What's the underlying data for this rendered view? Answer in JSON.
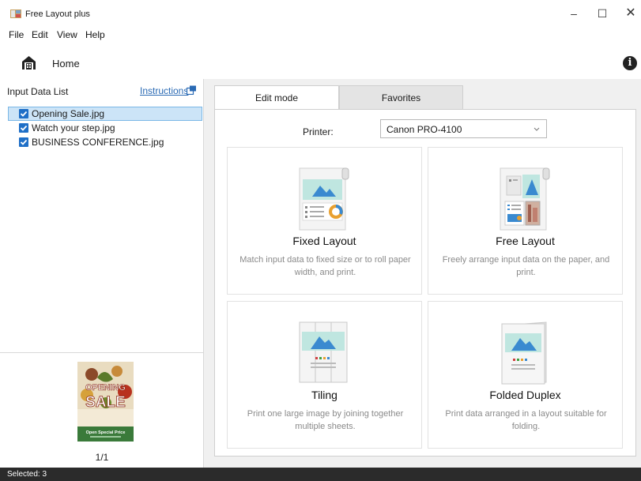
{
  "window": {
    "title": "Free Layout plus",
    "minimize": "–",
    "maximize": "☐",
    "close": "✕"
  },
  "menu": {
    "file": "File",
    "edit": "Edit",
    "view": "View",
    "help": "Help"
  },
  "toolbar": {
    "home_label": "Home",
    "info_icon": "i"
  },
  "input_panel": {
    "title": "Input Data List",
    "instructions_link": "Instructions",
    "files": [
      {
        "name": "Opening Sale.jpg",
        "checked": true,
        "selected": true
      },
      {
        "name": "Watch your step.jpg",
        "checked": true,
        "selected": false
      },
      {
        "name": "BUSINESS CONFERENCE.jpg",
        "checked": true,
        "selected": false
      }
    ],
    "preview_text": {
      "line1": "OPENING",
      "line2": "SALE",
      "footer": "Open Special Price"
    },
    "page_counter": "1/1"
  },
  "tabs": [
    {
      "label": "Edit mode",
      "active": true
    },
    {
      "label": "Favorites",
      "active": false
    }
  ],
  "printer": {
    "label": "Printer:",
    "value": "Canon PRO-4100"
  },
  "layouts": [
    {
      "title": "Fixed Layout",
      "description": "Match input data to fixed size or to roll paper width, and print."
    },
    {
      "title": "Free Layout",
      "description": "Freely arrange input data on the paper, and print."
    },
    {
      "title": "Tiling",
      "description": "Print one large image by joining together multiple sheets."
    },
    {
      "title": "Folded Duplex",
      "description": "Print data arranged in a layout suitable for folding."
    }
  ],
  "status": {
    "text": "Selected: 3"
  },
  "colors": {
    "accent": "#1f6fc7",
    "selection": "#cce4f7",
    "statusbar": "#2b2b2b",
    "link": "#2a6ab4"
  }
}
